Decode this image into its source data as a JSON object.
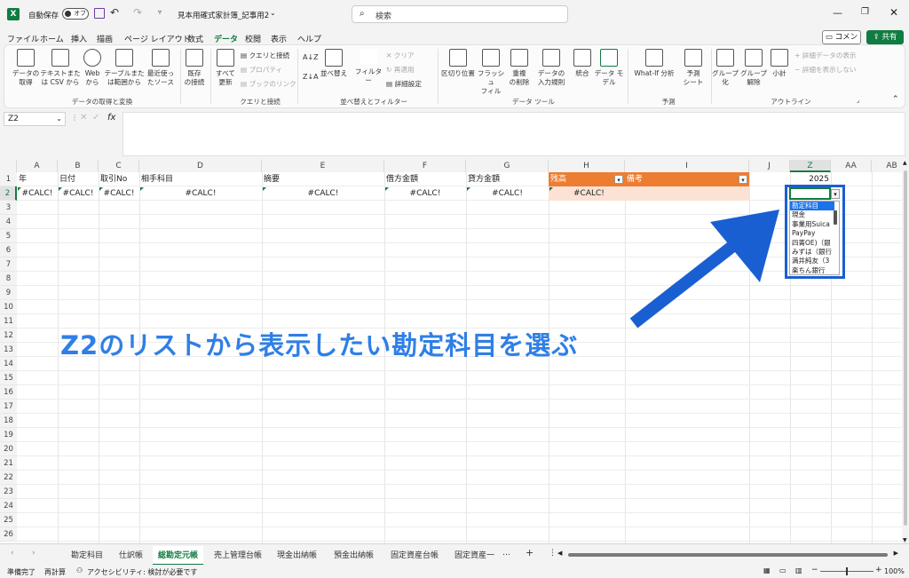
{
  "title_bar": {
    "autosave_label": "自動保存",
    "autosave_state": "オフ",
    "file_name": "見本用確式家計簿_記事用2",
    "search_placeholder": "検索",
    "app_color": "#107c41"
  },
  "menu": {
    "tabs": [
      "ファイル",
      "ホーム",
      "挿入",
      "描画",
      "ページ レイアウト",
      "数式",
      "データ",
      "校閲",
      "表示",
      "ヘルプ"
    ],
    "active_tab": "データ",
    "comment_button": "コメント",
    "share_button": "共有"
  },
  "ribbon": {
    "get_data": {
      "label": "データの取得と変換",
      "buttons": [
        "データの\n取得",
        "テキストまた\nは CSV から",
        "Web\nから",
        "テーブルまた\nは範囲から",
        "最近使っ\nたソース",
        "既存\nの接続"
      ]
    },
    "queries": {
      "label": "クエリと接続",
      "refresh": "すべて\n更新",
      "small": [
        "クエリと接続",
        "プロパティ",
        "ブックのリンク"
      ]
    },
    "sort_filter": {
      "label": "並べ替えとフィルター",
      "sort": "並べ替え",
      "filter": "フィルター",
      "small": [
        "クリア",
        "再適用",
        "詳細設定"
      ]
    },
    "data_tools": {
      "label": "データ ツール",
      "buttons": [
        "区切り位置",
        "フラッシュ\nフィル",
        "重複\nの削除",
        "データの\n入力規則",
        "統合",
        "データ モ\nデル"
      ]
    },
    "forecast": {
      "label": "予測",
      "buttons": [
        "What-If 分析",
        "予測\nシート"
      ]
    },
    "outline": {
      "label": "アウトライン",
      "buttons": [
        "グループ\n化",
        "グループ\n解除",
        "小計"
      ],
      "small": [
        "詳細データの表示",
        "詳細を表示しない"
      ]
    }
  },
  "formula_bar": {
    "name_box": "Z2",
    "fx": "fx",
    "formula": ""
  },
  "columns": [
    "A",
    "B",
    "C",
    "D",
    "E",
    "F",
    "G",
    "H",
    "I",
    "J",
    "Z",
    "AA",
    "AB"
  ],
  "rows": [
    "1",
    "2",
    "3",
    "4",
    "5",
    "6",
    "7",
    "8",
    "9",
    "10",
    "11",
    "12",
    "13",
    "14",
    "15",
    "16",
    "17",
    "18",
    "19",
    "20",
    "21",
    "22",
    "23",
    "24",
    "25",
    "26"
  ],
  "headers": [
    "年",
    "日付",
    "取引No",
    "相手科目",
    "摘要",
    "借方金額",
    "貸方金額",
    "残高",
    "備考"
  ],
  "row2": [
    "#CALC!",
    "#CALC!",
    "#CALC!",
    "#CALC!",
    "#CALC!",
    "#CALC!",
    "#CALC!",
    "#CALC!"
  ],
  "z1_value": "2025",
  "dropdown": {
    "items": [
      "勘定科目",
      "現金",
      "事業用Suica",
      "PayPay",
      "四菁OE)（銀",
      "みずは（銀行",
      "満井純友（3",
      "楽ちん銀行"
    ],
    "selected": "勘定科目"
  },
  "annotation": {
    "text": "Z2のリストから表示したい勘定科目を選ぶ",
    "color": "#1a73e8"
  },
  "sheet_tabs": [
    "勘定科目",
    "仕訳帳",
    "総勘定元帳",
    "売上管理台帳",
    "現金出納帳",
    "預金出納帳",
    "固定資産台帳",
    "固定資産一"
  ],
  "active_sheet": "総勘定元帳",
  "status": {
    "ready": "準備完了",
    "recalc": "再計算",
    "accessibility": "アクセシビリティ: 検討が必要です",
    "zoom": "100%"
  }
}
